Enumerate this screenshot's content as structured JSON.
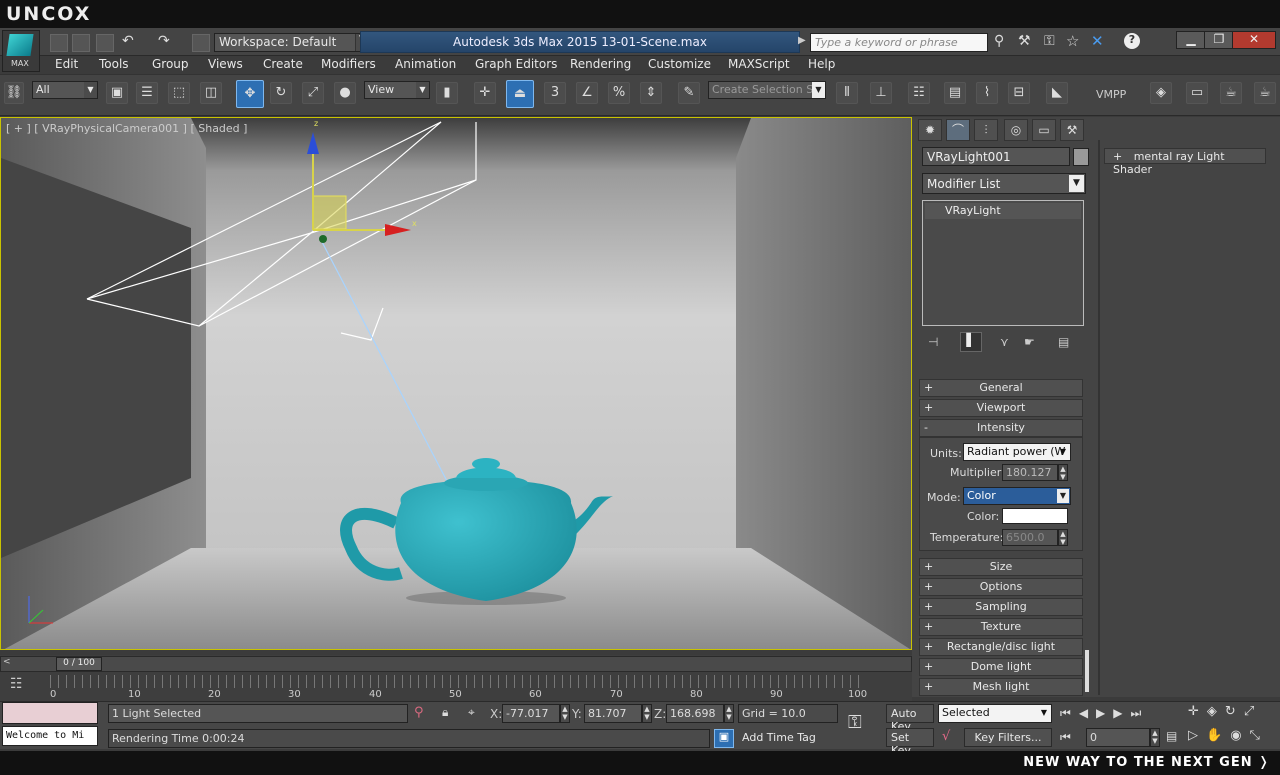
{
  "brand": {
    "logo": "UNCOX",
    "tagline": "NEW WAY TO THE NEXT GEN ❭"
  },
  "titlebar": {
    "max_button_label": "MAX",
    "workspace": "Workspace: Default",
    "window_title": "Autodesk 3ds Max  2015     13-01-Scene.max",
    "search_placeholder": "Type a keyword or phrase"
  },
  "menu": [
    "Edit",
    "Tools",
    "Group",
    "Views",
    "Create",
    "Modifiers",
    "Animation",
    "Graph Editors",
    "Rendering",
    "Customize",
    "MAXScript",
    "Help"
  ],
  "toolbar": {
    "selection_filter": "All",
    "ref_coord": "View",
    "snap_3": "3",
    "named_selection_placeholder": "Create Selection Se",
    "vmpp": "VMPP"
  },
  "viewport": {
    "label": "[ + ] [ VRayPhysicalCamera001 ] [ Shaded ]",
    "axis_z": "z",
    "axis_x": "x"
  },
  "command_panel": {
    "object_name": "VRayLight001",
    "modifier_list": "Modifier List",
    "stack_item": "VRayLight",
    "rollouts_top": [
      {
        "sign": "+",
        "label": "General"
      },
      {
        "sign": "+",
        "label": "Viewport"
      },
      {
        "sign": "-",
        "label": "Intensity"
      }
    ],
    "intensity": {
      "units_label": "Units:",
      "units_value": "Radiant power (W",
      "multiplier_label": "Multiplier:",
      "multiplier_value": "180.127",
      "mode_label": "Mode:",
      "mode_value": "Color",
      "color_label": "Color:",
      "temperature_label": "Temperature:",
      "temperature_value": "6500.0"
    },
    "rollouts_bottom": [
      {
        "sign": "+",
        "label": "Size"
      },
      {
        "sign": "+",
        "label": "Options"
      },
      {
        "sign": "+",
        "label": "Sampling"
      },
      {
        "sign": "+",
        "label": "Texture"
      },
      {
        "sign": "+",
        "label": "Rectangle/disc light"
      },
      {
        "sign": "+",
        "label": "Dome light"
      },
      {
        "sign": "+",
        "label": "Mesh light"
      }
    ],
    "shader_rollout": {
      "sign": "+",
      "label": "mental ray Light Shader"
    }
  },
  "timeline": {
    "frame_display": "0 / 100",
    "ticks": [
      "0",
      "10",
      "20",
      "30",
      "40",
      "50",
      "60",
      "70",
      "80",
      "90",
      "100"
    ]
  },
  "status": {
    "selection": "1 Light Selected",
    "prompt": "Rendering Time  0:00:24",
    "listener": "Welcome to Mi",
    "x_label": "X:",
    "x": "-77.017",
    "y_label": "Y:",
    "y": "81.707",
    "z_label": "Z:",
    "z": "168.698",
    "grid": "Grid = 10.0",
    "add_time_tag": "Add Time Tag",
    "auto_key": "Auto Key",
    "set_key": "Set Key",
    "key_mode": "Selected",
    "key_filters": "Key Filters...",
    "current_frame": "0"
  }
}
